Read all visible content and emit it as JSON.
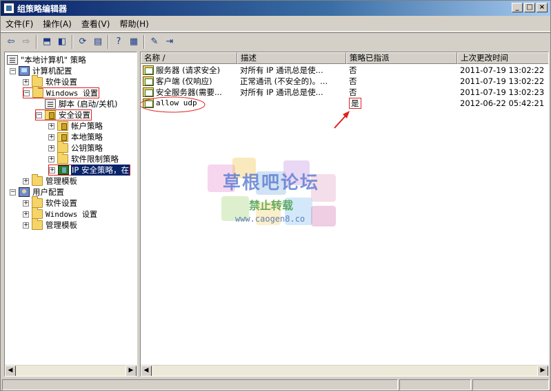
{
  "window": {
    "title": "组策略编辑器",
    "controls": [
      "_",
      "□",
      "×"
    ]
  },
  "menubar": [
    "文件(F)",
    "操作(A)",
    "查看(V)",
    "帮助(H)"
  ],
  "tree": {
    "root": "\"本地计算机\" 策略",
    "computer_config": "计算机配置",
    "software_settings": "软件设置",
    "windows_settings": "Windows 设置",
    "scripts": "脚本 (启动/关机)",
    "security_settings": "安全设置",
    "account_policies": "帐户策略",
    "local_policies": "本地策略",
    "public_key_policies": "公钥策略",
    "software_restriction": "软件限制策略",
    "ipsec": "IP 安全策略，在",
    "admin_templates": "管理模板",
    "user_config": "用户配置",
    "user_software_settings": "软件设置",
    "user_windows_settings": "Windows 设置",
    "user_admin_templates": "管理模板"
  },
  "list": {
    "columns": [
      "名称 /",
      "描述",
      "策略已指派",
      "上次更改时间"
    ],
    "rows": [
      {
        "name": "服务器 (请求安全)",
        "description": "对所有 IP 通讯总是使...",
        "assigned": "否",
        "modified": "2011-07-19 13:02:22"
      },
      {
        "name": "客户端 (仅响应)",
        "description": "正常通讯 (不安全的)。...",
        "assigned": "否",
        "modified": "2011-07-19 13:02:22"
      },
      {
        "name": "安全服务器(需要...",
        "description": "对所有 IP 通讯总是使...",
        "assigned": "否",
        "modified": "2011-07-19 13:02:23"
      },
      {
        "name": "allow udp",
        "description": "",
        "assigned": "是",
        "modified": "2012-06-22 05:42:21"
      }
    ]
  },
  "watermark": {
    "title": "草根吧论坛",
    "subtitle": "禁止转载",
    "url": "www.caogen8.co"
  },
  "colors": {
    "title_bar": "#0a246a",
    "selection": "#0a246a",
    "annotation": "#e02020"
  }
}
